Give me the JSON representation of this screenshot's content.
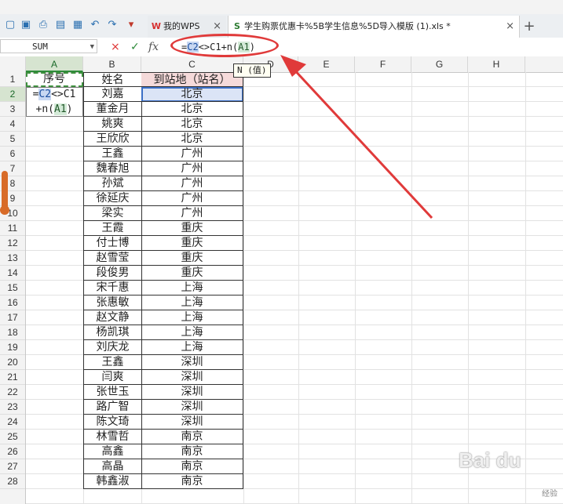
{
  "tabs": {
    "wps_home": "我的WPS",
    "file": "学生购票优惠卡%5B学生信息%5D导入模版 (1).xls *"
  },
  "formula_bar": {
    "name_box": "SUM",
    "formula_prefix": "=",
    "formula_ref1": "C2",
    "formula_mid": "<>C1+n(",
    "formula_ref2": "A1",
    "formula_suffix": ")",
    "cancel_icon": "×",
    "confirm_icon": "✓",
    "fx_label": "fx"
  },
  "tooltip": "N (值)",
  "columns": [
    "A",
    "B",
    "C",
    "D",
    "E",
    "F",
    "G",
    "H"
  ],
  "rows": [
    "1",
    "2",
    "3",
    "4",
    "5",
    "6",
    "7",
    "8",
    "9",
    "10",
    "11",
    "12",
    "13",
    "14",
    "15",
    "16",
    "17",
    "18",
    "19",
    "20",
    "21",
    "22",
    "23",
    "24",
    "25",
    "26",
    "27",
    "28"
  ],
  "sheet": {
    "a1": "序号",
    "a2_part1": "=",
    "a2_ref1": "C2",
    "a2_part2": "<>C1",
    "a3_part1": "+n(",
    "a3_ref2": "A1",
    "a3_part2": ")",
    "header_b": "姓名",
    "header_c": "到站地（站名）",
    "names": [
      "刘嘉",
      "董金月",
      "姚爽",
      "王欣欣",
      "王鑫",
      "魏春旭",
      "孙斌",
      "徐延庆",
      "梁实",
      "王霞",
      "付士博",
      "赵雪莹",
      "段俊男",
      "宋千惠",
      "张惠敏",
      "赵文静",
      "杨凯琪",
      "刘庆龙",
      "王鑫",
      "闫爽",
      "张世玉",
      "路广智",
      "陈文琦",
      "林雪哲",
      "高鑫",
      "高晶",
      "韩鑫淑"
    ],
    "stations": [
      "北京",
      "北京",
      "北京",
      "北京",
      "广州",
      "广州",
      "广州",
      "广州",
      "广州",
      "重庆",
      "重庆",
      "重庆",
      "重庆",
      "上海",
      "上海",
      "上海",
      "上海",
      "上海",
      "深圳",
      "深圳",
      "深圳",
      "深圳",
      "深圳",
      "南京",
      "南京",
      "南京",
      "南京"
    ]
  },
  "watermark": {
    "brand": "Bai du",
    "sub": "经验"
  },
  "colors": {
    "accent_green": "#2e8b3a",
    "selection_blue": "#3b6fc6",
    "annotation_red": "#e03a3a"
  }
}
